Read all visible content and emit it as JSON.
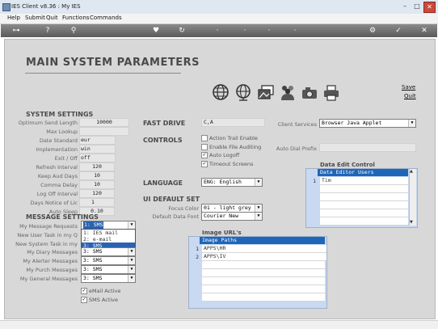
{
  "window": {
    "title": "IES Client v8.36 : My IES"
  },
  "menu": [
    "Help",
    "Submit",
    "Quit",
    "Functions",
    "Commands"
  ],
  "page": {
    "title": "MAIN SYSTEM PARAMETERS",
    "save_label": "Save",
    "quit_label": "Quit"
  },
  "system_settings": {
    "heading": "SYSTEM SETTINGS",
    "fields": [
      {
        "label": "Optimum Send Length",
        "value": "10000"
      },
      {
        "label": "Max Lookup",
        "value": ""
      },
      {
        "label": "Date Standard",
        "value": "eur"
      },
      {
        "label": "Implementation",
        "value": "win"
      },
      {
        "label": "Exit / Off",
        "value": "off"
      },
      {
        "label": "Refresh Interval",
        "value": "120"
      },
      {
        "label": "Keep Aud Days",
        "value": "10"
      },
      {
        "label": "Comma Delay",
        "value": "10"
      },
      {
        "label": "Log Off Interval",
        "value": "120"
      },
      {
        "label": "Days Notice of Lic",
        "value": "1"
      },
      {
        "label": "Auto Sleep",
        "value": "0.10"
      }
    ]
  },
  "message_settings": {
    "heading": "MESSAGE SETTINGS",
    "fields": [
      {
        "label": "My Message Requests",
        "value": "1: SMS"
      },
      {
        "label": "New User Task in my Q",
        "value": ""
      },
      {
        "label": "New System Task in my",
        "value": ""
      },
      {
        "label": "My Diary Messages",
        "value": "3: SMS"
      },
      {
        "label": "My Alerter Messages",
        "value": "3: SMS"
      },
      {
        "label": "My Purch Messages",
        "value": "3: SMS"
      },
      {
        "label": "My General Messages",
        "value": "3: SMS"
      }
    ],
    "dropdown_options": [
      "1: IES mail",
      "2: e-mail",
      "3: SMS"
    ],
    "email_active": "eMail Active",
    "sms_active": "SMS Active"
  },
  "fast_drive": {
    "label": "FAST DRIVE",
    "value": "C,A"
  },
  "controls": {
    "label": "CONTROLS",
    "options": [
      {
        "label": "Action Trail Enable",
        "checked": false
      },
      {
        "label": "Enable File Auditing",
        "checked": false
      },
      {
        "label": "Auto Logoff",
        "checked": true
      },
      {
        "label": "Timeout Screens",
        "checked": true
      }
    ]
  },
  "language": {
    "label": "LANGUAGE",
    "value": "ENG: English"
  },
  "ui_default": {
    "heading": "UI DEFAULT SET",
    "focus_label": "Focus Color",
    "focus_value": "01 - light grey",
    "font_label": "Default Data Font",
    "font_value": "Courier New"
  },
  "client_services": {
    "label": "Client Services",
    "value": "Browser Java Applet"
  },
  "auto_dial": {
    "label": "Auto Dial Prefix",
    "value": ""
  },
  "data_edit": {
    "heading": "Data Edit Control",
    "column": "Data Editor Users",
    "rows": [
      {
        "num": "1",
        "value": "Tim"
      }
    ]
  },
  "image_urls": {
    "heading": "Image URL's",
    "column": "Image Paths",
    "rows": [
      {
        "num": "1",
        "value": "APPS\\HR"
      },
      {
        "num": "2",
        "value": "APPS\\IV"
      }
    ]
  },
  "icons": [
    "globe-icon",
    "globe-network-icon",
    "photo-gallery-icon",
    "users-group-icon",
    "camera-icon",
    "printer-icon"
  ]
}
